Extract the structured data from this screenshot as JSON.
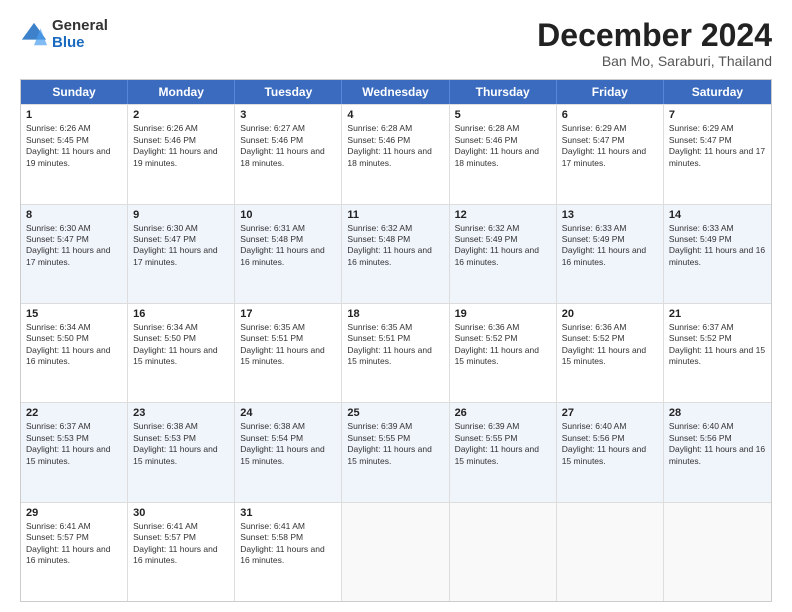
{
  "logo": {
    "general": "General",
    "blue": "Blue"
  },
  "title": "December 2024",
  "location": "Ban Mo, Saraburi, Thailand",
  "headers": [
    "Sunday",
    "Monday",
    "Tuesday",
    "Wednesday",
    "Thursday",
    "Friday",
    "Saturday"
  ],
  "rows": [
    [
      {
        "day": "",
        "sunrise": "",
        "sunset": "",
        "daylight": "",
        "empty": true
      },
      {
        "day": "2",
        "sunrise": "Sunrise: 6:26 AM",
        "sunset": "Sunset: 5:46 PM",
        "daylight": "Daylight: 11 hours and 19 minutes."
      },
      {
        "day": "3",
        "sunrise": "Sunrise: 6:27 AM",
        "sunset": "Sunset: 5:46 PM",
        "daylight": "Daylight: 11 hours and 18 minutes."
      },
      {
        "day": "4",
        "sunrise": "Sunrise: 6:28 AM",
        "sunset": "Sunset: 5:46 PM",
        "daylight": "Daylight: 11 hours and 18 minutes."
      },
      {
        "day": "5",
        "sunrise": "Sunrise: 6:28 AM",
        "sunset": "Sunset: 5:46 PM",
        "daylight": "Daylight: 11 hours and 18 minutes."
      },
      {
        "day": "6",
        "sunrise": "Sunrise: 6:29 AM",
        "sunset": "Sunset: 5:47 PM",
        "daylight": "Daylight: 11 hours and 17 minutes."
      },
      {
        "day": "7",
        "sunrise": "Sunrise: 6:29 AM",
        "sunset": "Sunset: 5:47 PM",
        "daylight": "Daylight: 11 hours and 17 minutes."
      }
    ],
    [
      {
        "day": "8",
        "sunrise": "Sunrise: 6:30 AM",
        "sunset": "Sunset: 5:47 PM",
        "daylight": "Daylight: 11 hours and 17 minutes."
      },
      {
        "day": "9",
        "sunrise": "Sunrise: 6:30 AM",
        "sunset": "Sunset: 5:47 PM",
        "daylight": "Daylight: 11 hours and 17 minutes."
      },
      {
        "day": "10",
        "sunrise": "Sunrise: 6:31 AM",
        "sunset": "Sunset: 5:48 PM",
        "daylight": "Daylight: 11 hours and 16 minutes."
      },
      {
        "day": "11",
        "sunrise": "Sunrise: 6:32 AM",
        "sunset": "Sunset: 5:48 PM",
        "daylight": "Daylight: 11 hours and 16 minutes."
      },
      {
        "day": "12",
        "sunrise": "Sunrise: 6:32 AM",
        "sunset": "Sunset: 5:49 PM",
        "daylight": "Daylight: 11 hours and 16 minutes."
      },
      {
        "day": "13",
        "sunrise": "Sunrise: 6:33 AM",
        "sunset": "Sunset: 5:49 PM",
        "daylight": "Daylight: 11 hours and 16 minutes."
      },
      {
        "day": "14",
        "sunrise": "Sunrise: 6:33 AM",
        "sunset": "Sunset: 5:49 PM",
        "daylight": "Daylight: 11 hours and 16 minutes."
      }
    ],
    [
      {
        "day": "15",
        "sunrise": "Sunrise: 6:34 AM",
        "sunset": "Sunset: 5:50 PM",
        "daylight": "Daylight: 11 hours and 16 minutes."
      },
      {
        "day": "16",
        "sunrise": "Sunrise: 6:34 AM",
        "sunset": "Sunset: 5:50 PM",
        "daylight": "Daylight: 11 hours and 15 minutes."
      },
      {
        "day": "17",
        "sunrise": "Sunrise: 6:35 AM",
        "sunset": "Sunset: 5:51 PM",
        "daylight": "Daylight: 11 hours and 15 minutes."
      },
      {
        "day": "18",
        "sunrise": "Sunrise: 6:35 AM",
        "sunset": "Sunset: 5:51 PM",
        "daylight": "Daylight: 11 hours and 15 minutes."
      },
      {
        "day": "19",
        "sunrise": "Sunrise: 6:36 AM",
        "sunset": "Sunset: 5:52 PM",
        "daylight": "Daylight: 11 hours and 15 minutes."
      },
      {
        "day": "20",
        "sunrise": "Sunrise: 6:36 AM",
        "sunset": "Sunset: 5:52 PM",
        "daylight": "Daylight: 11 hours and 15 minutes."
      },
      {
        "day": "21",
        "sunrise": "Sunrise: 6:37 AM",
        "sunset": "Sunset: 5:52 PM",
        "daylight": "Daylight: 11 hours and 15 minutes."
      }
    ],
    [
      {
        "day": "22",
        "sunrise": "Sunrise: 6:37 AM",
        "sunset": "Sunset: 5:53 PM",
        "daylight": "Daylight: 11 hours and 15 minutes."
      },
      {
        "day": "23",
        "sunrise": "Sunrise: 6:38 AM",
        "sunset": "Sunset: 5:53 PM",
        "daylight": "Daylight: 11 hours and 15 minutes."
      },
      {
        "day": "24",
        "sunrise": "Sunrise: 6:38 AM",
        "sunset": "Sunset: 5:54 PM",
        "daylight": "Daylight: 11 hours and 15 minutes."
      },
      {
        "day": "25",
        "sunrise": "Sunrise: 6:39 AM",
        "sunset": "Sunset: 5:55 PM",
        "daylight": "Daylight: 11 hours and 15 minutes."
      },
      {
        "day": "26",
        "sunrise": "Sunrise: 6:39 AM",
        "sunset": "Sunset: 5:55 PM",
        "daylight": "Daylight: 11 hours and 15 minutes."
      },
      {
        "day": "27",
        "sunrise": "Sunrise: 6:40 AM",
        "sunset": "Sunset: 5:56 PM",
        "daylight": "Daylight: 11 hours and 15 minutes."
      },
      {
        "day": "28",
        "sunrise": "Sunrise: 6:40 AM",
        "sunset": "Sunset: 5:56 PM",
        "daylight": "Daylight: 11 hours and 16 minutes."
      }
    ],
    [
      {
        "day": "29",
        "sunrise": "Sunrise: 6:41 AM",
        "sunset": "Sunset: 5:57 PM",
        "daylight": "Daylight: 11 hours and 16 minutes."
      },
      {
        "day": "30",
        "sunrise": "Sunrise: 6:41 AM",
        "sunset": "Sunset: 5:57 PM",
        "daylight": "Daylight: 11 hours and 16 minutes."
      },
      {
        "day": "31",
        "sunrise": "Sunrise: 6:41 AM",
        "sunset": "Sunset: 5:58 PM",
        "daylight": "Daylight: 11 hours and 16 minutes."
      },
      {
        "day": "",
        "sunrise": "",
        "sunset": "",
        "daylight": "",
        "empty": true
      },
      {
        "day": "",
        "sunrise": "",
        "sunset": "",
        "daylight": "",
        "empty": true
      },
      {
        "day": "",
        "sunrise": "",
        "sunset": "",
        "daylight": "",
        "empty": true
      },
      {
        "day": "",
        "sunrise": "",
        "sunset": "",
        "daylight": "",
        "empty": true
      }
    ]
  ],
  "row0_day1": {
    "day": "1",
    "sunrise": "Sunrise: 6:26 AM",
    "sunset": "Sunset: 5:45 PM",
    "daylight": "Daylight: 11 hours and 19 minutes."
  }
}
